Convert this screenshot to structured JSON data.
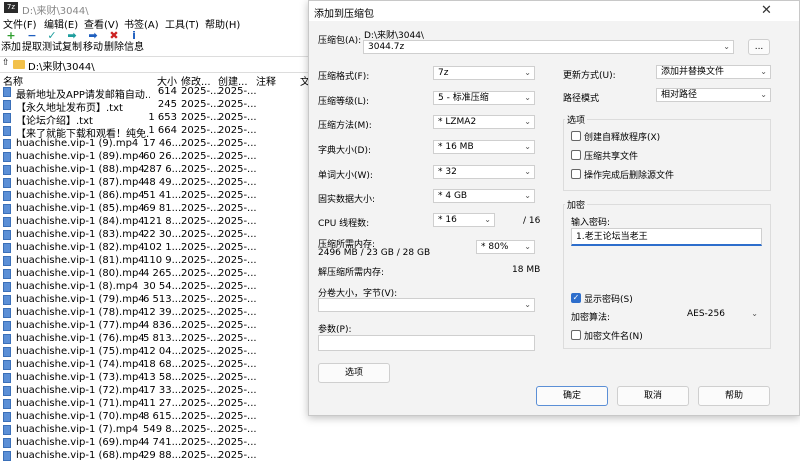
{
  "app": {
    "title": "D:\\来财\\3044\\",
    "icon_label": "7z",
    "menu": [
      "文件(F)",
      "编辑(E)",
      "查看(V)",
      "书签(A)",
      "工具(T)",
      "帮助(H)"
    ],
    "toolbar": [
      {
        "label": "添加",
        "icon": "+",
        "color": "#2e9e2e"
      },
      {
        "label": "提取",
        "icon": "−",
        "color": "#1f5fbf"
      },
      {
        "label": "测试",
        "icon": "✓",
        "color": "#1f9e9e"
      },
      {
        "label": "复制",
        "icon": "➡",
        "color": "#1f9e9e"
      },
      {
        "label": "移动",
        "icon": "➡",
        "color": "#1f5fbf"
      },
      {
        "label": "删除",
        "icon": "✖",
        "color": "#cc2222"
      },
      {
        "label": "信息",
        "icon": "i",
        "color": "#1f5fbf"
      }
    ],
    "address": "D:\\来财\\3044\\",
    "columns": {
      "name": "名称",
      "size": "大小",
      "modified": "修改...",
      "created": "创建...",
      "comment": "注释",
      "extra": "文"
    },
    "files": [
      {
        "name": "最新地址及APP请发邮箱自动...",
        "size": "614",
        "modified": "2025-...",
        "created": "2025-..."
      },
      {
        "name": "【永久地址发布页】.txt",
        "size": "245",
        "modified": "2025-...",
        "created": "2025-..."
      },
      {
        "name": "【论坛介绍】.txt",
        "size": "1 653",
        "modified": "2025-...",
        "created": "2025-..."
      },
      {
        "name": "【来了就能下载和观看！纯免...",
        "size": "1 664",
        "modified": "2025-...",
        "created": "2025-..."
      },
      {
        "name": "huachishe.vip-1 (9).mp4",
        "size": "17 46...",
        "modified": "2025-...",
        "created": "2025-..."
      },
      {
        "name": "huachishe.vip-1 (89).mp4",
        "size": "60 26...",
        "modified": "2025-...",
        "created": "2025-..."
      },
      {
        "name": "huachishe.vip-1 (88).mp4",
        "size": "287 6...",
        "modified": "2025-...",
        "created": "2025-..."
      },
      {
        "name": "huachishe.vip-1 (87).mp4",
        "size": "48 49...",
        "modified": "2025-...",
        "created": "2025-..."
      },
      {
        "name": "huachishe.vip-1 (86).mp4",
        "size": "51 41...",
        "modified": "2025-...",
        "created": "2025-..."
      },
      {
        "name": "huachishe.vip-1 (85).mp4",
        "size": "69 81...",
        "modified": "2025-...",
        "created": "2025-..."
      },
      {
        "name": "huachishe.vip-1 (84).mp4",
        "size": "121 8...",
        "modified": "2025-...",
        "created": "2025-..."
      },
      {
        "name": "huachishe.vip-1 (83).mp4",
        "size": "22 30...",
        "modified": "2025-...",
        "created": "2025-..."
      },
      {
        "name": "huachishe.vip-1 (82).mp4",
        "size": "102 1...",
        "modified": "2025-...",
        "created": "2025-..."
      },
      {
        "name": "huachishe.vip-1 (81).mp4",
        "size": "110 9...",
        "modified": "2025-...",
        "created": "2025-..."
      },
      {
        "name": "huachishe.vip-1 (80).mp4",
        "size": "4 265...",
        "modified": "2025-...",
        "created": "2025-..."
      },
      {
        "name": "huachishe.vip-1 (8).mp4",
        "size": "30 54...",
        "modified": "2025-...",
        "created": "2025-..."
      },
      {
        "name": "huachishe.vip-1 (79).mp4",
        "size": "6 513...",
        "modified": "2025-...",
        "created": "2025-..."
      },
      {
        "name": "huachishe.vip-1 (78).mp4",
        "size": "12 39...",
        "modified": "2025-...",
        "created": "2025-..."
      },
      {
        "name": "huachishe.vip-1 (77).mp4",
        "size": "4 836...",
        "modified": "2025-...",
        "created": "2025-..."
      },
      {
        "name": "huachishe.vip-1 (76).mp4",
        "size": "5 813...",
        "modified": "2025-...",
        "created": "2025-..."
      },
      {
        "name": "huachishe.vip-1 (75).mp4",
        "size": "12 04...",
        "modified": "2025-...",
        "created": "2025-..."
      },
      {
        "name": "huachishe.vip-1 (74).mp4",
        "size": "18 68...",
        "modified": "2025-...",
        "created": "2025-..."
      },
      {
        "name": "huachishe.vip-1 (73).mp4",
        "size": "13 58...",
        "modified": "2025-...",
        "created": "2025-..."
      },
      {
        "name": "huachishe.vip-1 (72).mp4",
        "size": "17 33...",
        "modified": "2025-...",
        "created": "2025-..."
      },
      {
        "name": "huachishe.vip-1 (71).mp4",
        "size": "11 27...",
        "modified": "2025-...",
        "created": "2025-..."
      },
      {
        "name": "huachishe.vip-1 (70).mp4",
        "size": "8 615...",
        "modified": "2025-...",
        "created": "2025-..."
      },
      {
        "name": "huachishe.vip-1 (7).mp4",
        "size": "549 8...",
        "modified": "2025-...",
        "created": "2025-..."
      },
      {
        "name": "huachishe.vip-1 (69).mp4",
        "size": "4 741...",
        "modified": "2025-...",
        "created": "2025-..."
      },
      {
        "name": "huachishe.vip-1 (68).mp4",
        "size": "29 88...",
        "modified": "2025-...",
        "created": "2025-..."
      }
    ]
  },
  "dialog": {
    "title": "添加到压缩包",
    "close_glyph": "✕",
    "archive_label": "压缩包(A):",
    "archive_dir": "D:\\来财\\3044\\",
    "archive_name": "3044.7z",
    "browse_label": "...",
    "format_label": "压缩格式(F):",
    "format_value": "7z",
    "level_label": "压缩等级(L):",
    "level_value": "5 - 标准压缩",
    "method_label": "压缩方法(M):",
    "method_value": "* LZMA2",
    "dict_label": "字典大小(D):",
    "dict_value": "* 16 MB",
    "word_label": "单词大小(W):",
    "word_value": "* 32",
    "solid_label": "固实数据大小:",
    "solid_value": "* 4 GB",
    "cpu_label": "CPU 线程数:",
    "cpu_value": "* 16",
    "cpu_total": "/ 16",
    "mem_label": "压缩所需内存:",
    "mem_value": "2496 MB / 23 GB / 28 GB",
    "mem_percent": "* 80%",
    "decomp_label": "解压缩所需内存:",
    "decomp_value": "18 MB",
    "split_label": "分卷大小，字节(V):",
    "split_value": "",
    "params_label": "参数(P):",
    "params_value": "",
    "options_button": "选项",
    "update_label": "更新方式(U):",
    "update_value": "添加并替换文件",
    "path_label": "路径模式",
    "path_value": "相对路径",
    "options_group": "选项",
    "opt_sfx": "创建自释放程序(X)",
    "opt_shared": "压缩共享文件",
    "opt_delete": "操作完成后删除源文件",
    "encrypt_group": "加密",
    "password_label": "输入密码:",
    "password_value": "1.老王论坛当老王",
    "show_password": "显示密码(S)",
    "enc_method_label": "加密算法:",
    "enc_method_value": "AES-256",
    "enc_names": "加密文件名(N)",
    "ok": "确定",
    "cancel": "取消",
    "help": "帮助"
  }
}
